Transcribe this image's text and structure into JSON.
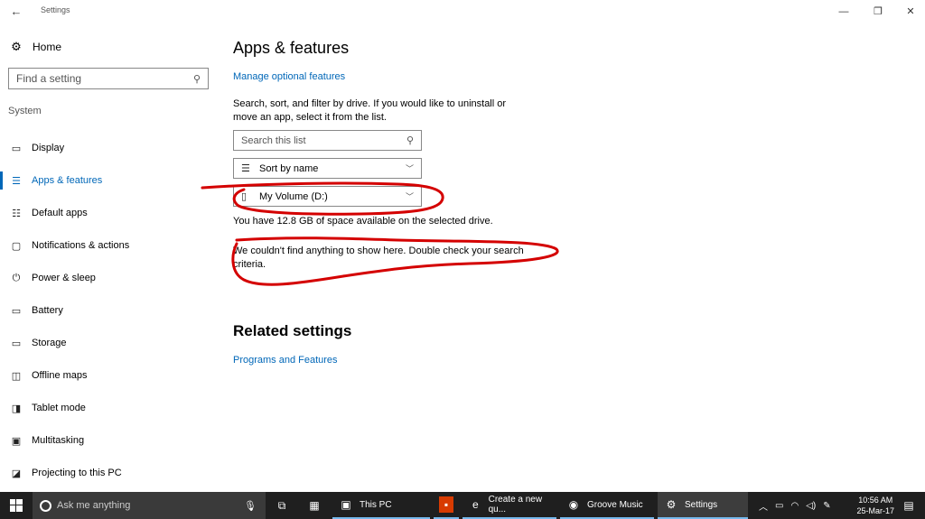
{
  "window": {
    "title": "Settings",
    "back_icon": "back-arrow-icon",
    "minimize": "—",
    "restore": "❐",
    "close": "✕"
  },
  "sidebar": {
    "home_label": "Home",
    "search_placeholder": "Find a setting",
    "section_label": "System",
    "items": [
      {
        "label": "Display",
        "icon": "display-icon",
        "glyph": "▭"
      },
      {
        "label": "Apps & features",
        "icon": "apps-features-icon",
        "glyph": "☰",
        "active": true
      },
      {
        "label": "Default apps",
        "icon": "default-apps-icon",
        "glyph": "☷"
      },
      {
        "label": "Notifications & actions",
        "icon": "notifications-icon",
        "glyph": "▢"
      },
      {
        "label": "Power & sleep",
        "icon": "power-icon",
        "glyph": "⏻"
      },
      {
        "label": "Battery",
        "icon": "battery-icon",
        "glyph": "▭"
      },
      {
        "label": "Storage",
        "icon": "storage-icon",
        "glyph": "▭"
      },
      {
        "label": "Offline maps",
        "icon": "map-icon",
        "glyph": "◫"
      },
      {
        "label": "Tablet mode",
        "icon": "tablet-icon",
        "glyph": "◨"
      },
      {
        "label": "Multitasking",
        "icon": "multitasking-icon",
        "glyph": "▣"
      },
      {
        "label": "Projecting to this PC",
        "icon": "projecting-icon",
        "glyph": "◪"
      }
    ]
  },
  "main": {
    "title": "Apps & features",
    "manage_link": "Manage optional features",
    "description": "Search, sort, and filter by drive. If you would like to uninstall or move an app, select it from the list.",
    "list_search_placeholder": "Search this list",
    "sort_label": "Sort by name",
    "drive_label": "My Volume (D:)",
    "space_text": "You have 12.8 GB of space available on the selected drive.",
    "empty_text": "We couldn't find anything to show here. Double check your search criteria.",
    "related_title": "Related settings",
    "programs_link": "Programs and Features"
  },
  "taskbar": {
    "cortana_placeholder": "Ask me anything",
    "apps": [
      {
        "label": "This PC",
        "icon": "file-explorer-icon"
      },
      {
        "label": "",
        "icon": "office-icon"
      },
      {
        "label": "Create a new qu...",
        "icon": "edge-icon"
      },
      {
        "label": "Groove Music",
        "icon": "groove-music-icon"
      },
      {
        "label": "Settings",
        "icon": "settings-gear-icon"
      }
    ],
    "time": "10:56 AM",
    "date": "25-Mar-17"
  },
  "colors": {
    "accent": "#0067b8",
    "annotation": "#d40000",
    "taskbar": "#1f1f1f"
  }
}
